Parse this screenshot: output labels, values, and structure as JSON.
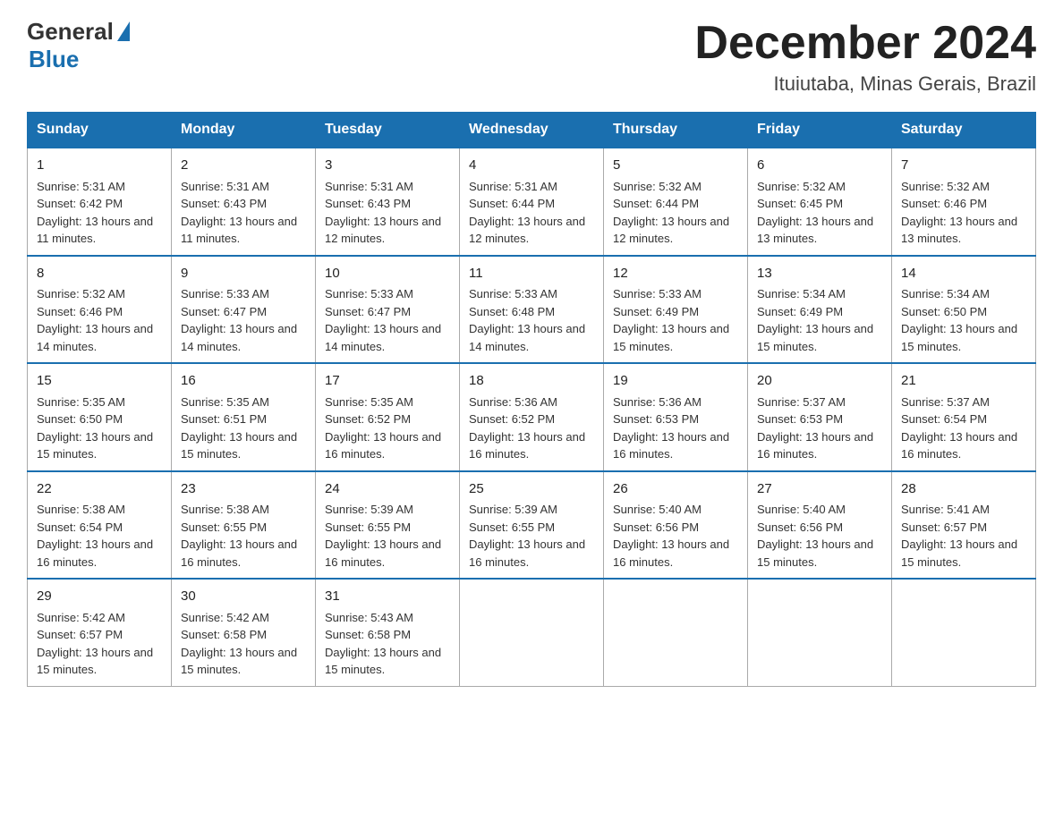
{
  "logo": {
    "general": "General",
    "blue": "Blue"
  },
  "title": "December 2024",
  "location": "Ituiutaba, Minas Gerais, Brazil",
  "weekdays": [
    "Sunday",
    "Monday",
    "Tuesday",
    "Wednesday",
    "Thursday",
    "Friday",
    "Saturday"
  ],
  "weeks": [
    [
      {
        "day": "1",
        "sunrise": "5:31 AM",
        "sunset": "6:42 PM",
        "daylight": "13 hours and 11 minutes."
      },
      {
        "day": "2",
        "sunrise": "5:31 AM",
        "sunset": "6:43 PM",
        "daylight": "13 hours and 11 minutes."
      },
      {
        "day": "3",
        "sunrise": "5:31 AM",
        "sunset": "6:43 PM",
        "daylight": "13 hours and 12 minutes."
      },
      {
        "day": "4",
        "sunrise": "5:31 AM",
        "sunset": "6:44 PM",
        "daylight": "13 hours and 12 minutes."
      },
      {
        "day": "5",
        "sunrise": "5:32 AM",
        "sunset": "6:44 PM",
        "daylight": "13 hours and 12 minutes."
      },
      {
        "day": "6",
        "sunrise": "5:32 AM",
        "sunset": "6:45 PM",
        "daylight": "13 hours and 13 minutes."
      },
      {
        "day": "7",
        "sunrise": "5:32 AM",
        "sunset": "6:46 PM",
        "daylight": "13 hours and 13 minutes."
      }
    ],
    [
      {
        "day": "8",
        "sunrise": "5:32 AM",
        "sunset": "6:46 PM",
        "daylight": "13 hours and 14 minutes."
      },
      {
        "day": "9",
        "sunrise": "5:33 AM",
        "sunset": "6:47 PM",
        "daylight": "13 hours and 14 minutes."
      },
      {
        "day": "10",
        "sunrise": "5:33 AM",
        "sunset": "6:47 PM",
        "daylight": "13 hours and 14 minutes."
      },
      {
        "day": "11",
        "sunrise": "5:33 AM",
        "sunset": "6:48 PM",
        "daylight": "13 hours and 14 minutes."
      },
      {
        "day": "12",
        "sunrise": "5:33 AM",
        "sunset": "6:49 PM",
        "daylight": "13 hours and 15 minutes."
      },
      {
        "day": "13",
        "sunrise": "5:34 AM",
        "sunset": "6:49 PM",
        "daylight": "13 hours and 15 minutes."
      },
      {
        "day": "14",
        "sunrise": "5:34 AM",
        "sunset": "6:50 PM",
        "daylight": "13 hours and 15 minutes."
      }
    ],
    [
      {
        "day": "15",
        "sunrise": "5:35 AM",
        "sunset": "6:50 PM",
        "daylight": "13 hours and 15 minutes."
      },
      {
        "day": "16",
        "sunrise": "5:35 AM",
        "sunset": "6:51 PM",
        "daylight": "13 hours and 15 minutes."
      },
      {
        "day": "17",
        "sunrise": "5:35 AM",
        "sunset": "6:52 PM",
        "daylight": "13 hours and 16 minutes."
      },
      {
        "day": "18",
        "sunrise": "5:36 AM",
        "sunset": "6:52 PM",
        "daylight": "13 hours and 16 minutes."
      },
      {
        "day": "19",
        "sunrise": "5:36 AM",
        "sunset": "6:53 PM",
        "daylight": "13 hours and 16 minutes."
      },
      {
        "day": "20",
        "sunrise": "5:37 AM",
        "sunset": "6:53 PM",
        "daylight": "13 hours and 16 minutes."
      },
      {
        "day": "21",
        "sunrise": "5:37 AM",
        "sunset": "6:54 PM",
        "daylight": "13 hours and 16 minutes."
      }
    ],
    [
      {
        "day": "22",
        "sunrise": "5:38 AM",
        "sunset": "6:54 PM",
        "daylight": "13 hours and 16 minutes."
      },
      {
        "day": "23",
        "sunrise": "5:38 AM",
        "sunset": "6:55 PM",
        "daylight": "13 hours and 16 minutes."
      },
      {
        "day": "24",
        "sunrise": "5:39 AM",
        "sunset": "6:55 PM",
        "daylight": "13 hours and 16 minutes."
      },
      {
        "day": "25",
        "sunrise": "5:39 AM",
        "sunset": "6:55 PM",
        "daylight": "13 hours and 16 minutes."
      },
      {
        "day": "26",
        "sunrise": "5:40 AM",
        "sunset": "6:56 PM",
        "daylight": "13 hours and 16 minutes."
      },
      {
        "day": "27",
        "sunrise": "5:40 AM",
        "sunset": "6:56 PM",
        "daylight": "13 hours and 15 minutes."
      },
      {
        "day": "28",
        "sunrise": "5:41 AM",
        "sunset": "6:57 PM",
        "daylight": "13 hours and 15 minutes."
      }
    ],
    [
      {
        "day": "29",
        "sunrise": "5:42 AM",
        "sunset": "6:57 PM",
        "daylight": "13 hours and 15 minutes."
      },
      {
        "day": "30",
        "sunrise": "5:42 AM",
        "sunset": "6:58 PM",
        "daylight": "13 hours and 15 minutes."
      },
      {
        "day": "31",
        "sunrise": "5:43 AM",
        "sunset": "6:58 PM",
        "daylight": "13 hours and 15 minutes."
      },
      null,
      null,
      null,
      null
    ]
  ]
}
